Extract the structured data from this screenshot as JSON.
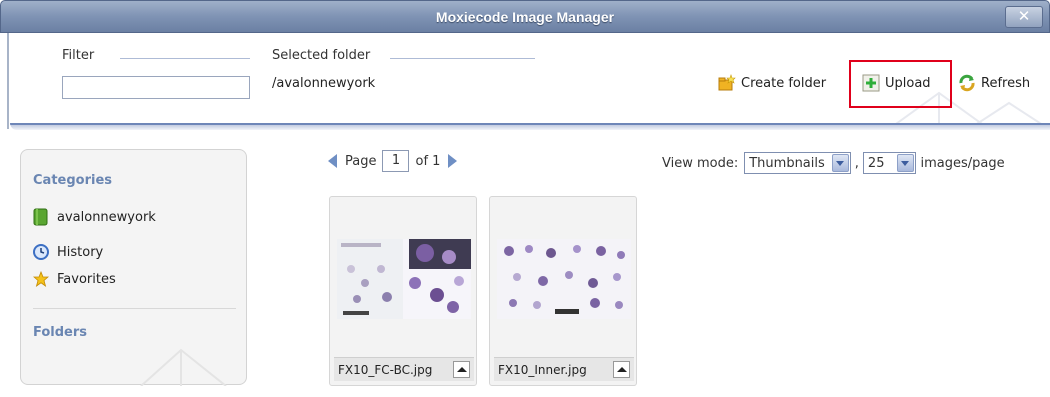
{
  "window": {
    "title": "Moxiecode Image Manager",
    "close_label": "✕"
  },
  "toolbar": {
    "filter_label": "Filter",
    "filter_value": "",
    "selected_folder_label": "Selected folder",
    "selected_folder_value": "/avalonnewyork",
    "create_folder_label": "Create folder",
    "upload_label": "Upload",
    "refresh_label": "Refresh"
  },
  "sidebar": {
    "categories_title": "Categories",
    "items": [
      {
        "label": "avalonnewyork",
        "icon": "book-icon"
      },
      {
        "label": "History",
        "icon": "clock-icon"
      },
      {
        "label": "Favorites",
        "icon": "star-icon"
      }
    ],
    "folders_title": "Folders"
  },
  "pager": {
    "page_label": "Page",
    "page_value": "1",
    "of_label": "of 1"
  },
  "view": {
    "label": "View mode:",
    "mode_value": "Thumbnails",
    "separator": ",",
    "per_page_value": "25",
    "per_page_suffix": "images/page"
  },
  "files": [
    {
      "name": "FX10_FC-BC.jpg"
    },
    {
      "name": "FX10_Inner.jpg"
    }
  ],
  "colors": {
    "highlight": "#e0001b",
    "accent": "#6a86b2",
    "titlebar": "#7f93b4"
  }
}
